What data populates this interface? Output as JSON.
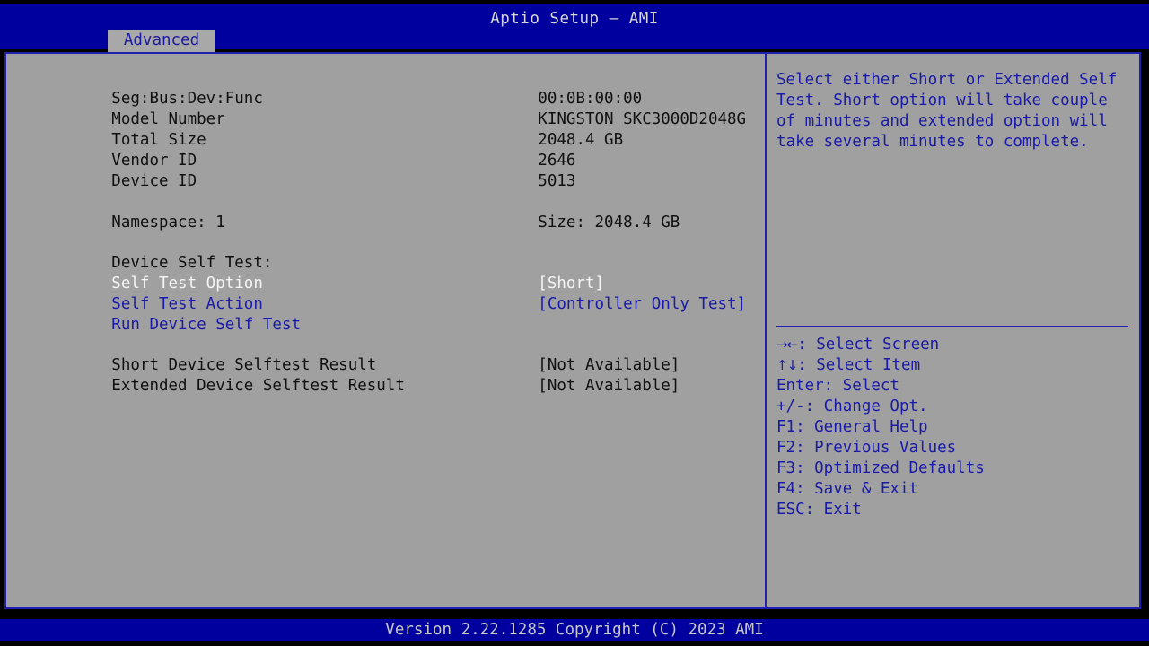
{
  "header": {
    "title": "Aptio Setup – AMI",
    "tab_label": "Advanced"
  },
  "colors": {
    "title_bar_blue": "#00009e",
    "panel_gray": "#a0a0a0",
    "border_blue": "#2020b0",
    "text_blue": "#1a1aa8",
    "text_dark": "#101010",
    "text_selected": "#f4f4f4",
    "tab_gray": "#a8a8a8"
  },
  "main": {
    "info_rows": [
      {
        "label": "Seg:Bus:Dev:Func",
        "value": "00:0B:00:00"
      },
      {
        "label": "Model Number",
        "value": "KINGSTON SKC3000D2048G"
      },
      {
        "label": "Total Size",
        "value": "2048.4 GB"
      },
      {
        "label": "Vendor ID",
        "value": "2646"
      },
      {
        "label": "Device ID",
        "value": "5013"
      }
    ],
    "namespace_label": "Namespace: 1",
    "namespace_size": "Size: 2048.4 GB",
    "section_heading": "Device Self Test:",
    "self_test_option_label": "Self Test Option",
    "self_test_option_value": "[Short]",
    "self_test_action_label": "Self Test Action",
    "self_test_action_value": "[Controller Only Test]",
    "run_device_self_test_label": "Run Device Self Test",
    "short_result_label": "Short Device Selftest Result",
    "short_result_value": "[Not Available]",
    "extended_result_label": "Extended Device Selftest Result",
    "extended_result_value": "[Not Available]"
  },
  "help": {
    "text": "Select either Short or Extended Self Test. Short option will take couple of minutes and extended option will take several minutes to complete."
  },
  "keys": {
    "select_screen_glyph": "→←",
    "select_screen_label": ": Select Screen",
    "select_item_glyph": "↑↓",
    "select_item_label": ": Select Item",
    "enter": "Enter: Select",
    "change_opt": "+/-: Change Opt.",
    "f1": "F1: General Help",
    "f2": "F2: Previous Values",
    "f3": "F3: Optimized Defaults",
    "f4": "F4: Save & Exit",
    "esc": "ESC: Exit"
  },
  "footer": {
    "text": "Version 2.22.1285 Copyright (C) 2023 AMI"
  }
}
